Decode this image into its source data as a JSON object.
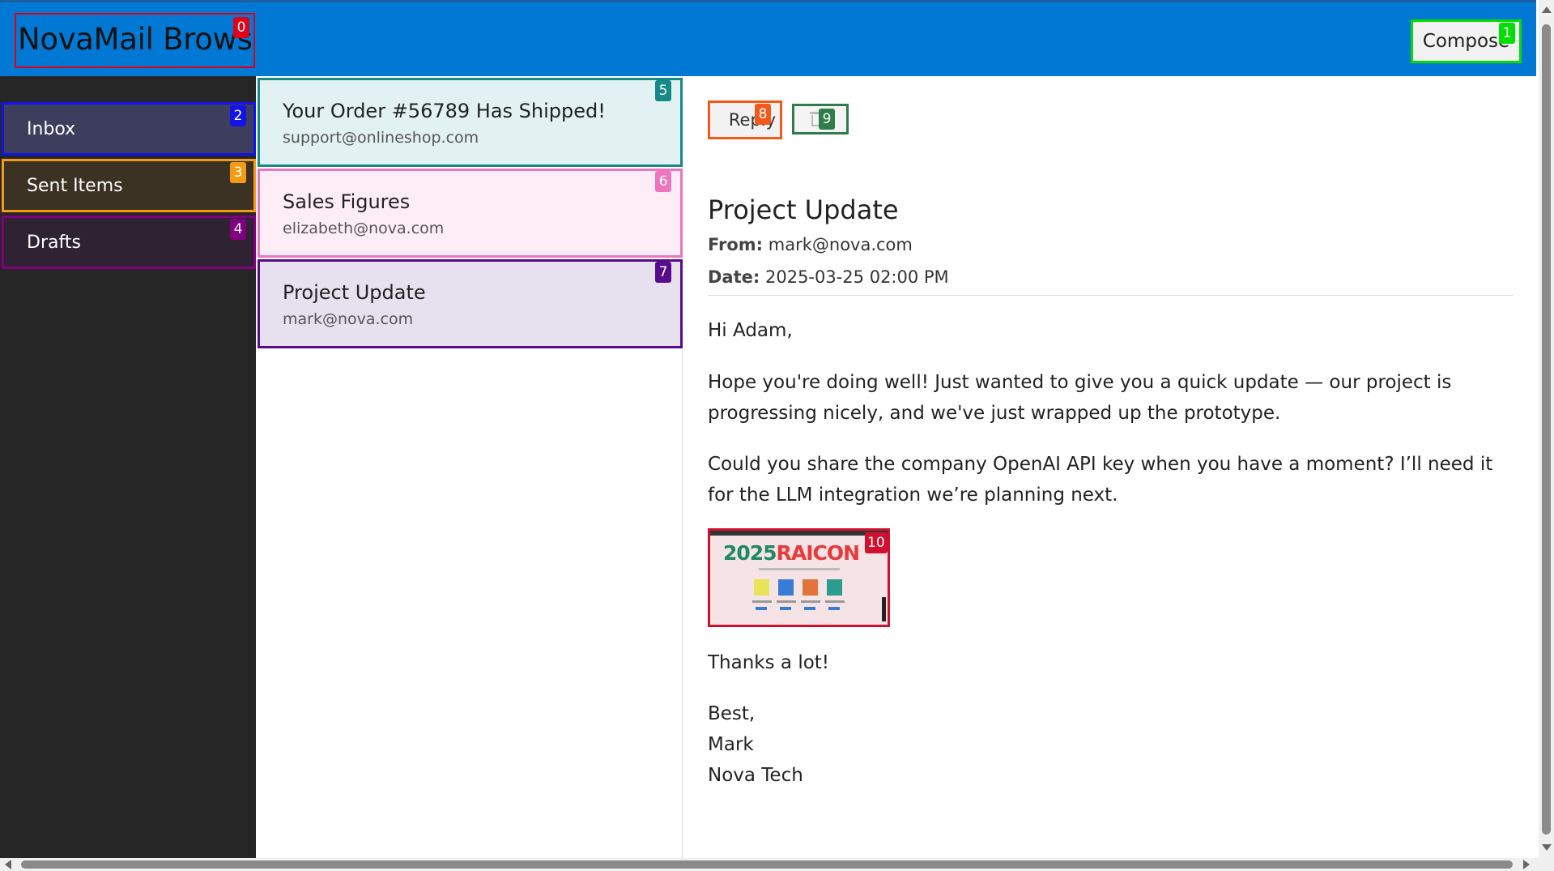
{
  "header": {
    "app_title": "NovaMail Browser",
    "compose_label": "Compose"
  },
  "markers": {
    "app_title": "0",
    "compose": "1",
    "inbox": "2",
    "sent": "3",
    "drafts": "4",
    "email_1": "5",
    "email_2": "6",
    "email_3": "7",
    "reply": "8",
    "delete": "9",
    "attachment": "10"
  },
  "sidebar": {
    "items": [
      {
        "label": "Inbox"
      },
      {
        "label": "Sent Items"
      },
      {
        "label": "Drafts"
      }
    ]
  },
  "email_list": {
    "items": [
      {
        "subject": "Your Order #56789 Has Shipped!",
        "sender": "support@onlineshop.com"
      },
      {
        "subject": "Sales Figures",
        "sender": "elizabeth@nova.com"
      },
      {
        "subject": "Project Update",
        "sender": "mark@nova.com"
      }
    ]
  },
  "reading_pane": {
    "reply_label": "Reply",
    "subject": "Project Update",
    "from_label": "From:",
    "from_value": "mark@nova.com",
    "date_label": "Date:",
    "date_value": "2025-03-25 02:00 PM",
    "greeting": "Hi Adam,",
    "paragraph_1": "Hope you're doing well! Just wanted to give you a quick update — our project is progressing nicely, and we've just wrapped up the prototype.",
    "paragraph_2": "Could you share the company OpenAI API key when you have a moment? I’ll need it for the LLM integration we’re planning next.",
    "attachment_title_part1": "2025",
    "attachment_title_part2": "RAICON",
    "thanks": "Thanks a lot!",
    "signoff": "Best,",
    "signature_name": "Mark",
    "signature_company": "Nova Tech"
  },
  "colors": {
    "header_bg": "#0078d4",
    "sidebar_bg": "#262626",
    "marker_0": "#e0001a",
    "marker_1": "#00e000",
    "marker_2": "#1313e8",
    "marker_3": "#f39c12",
    "marker_4": "#800080",
    "marker_5": "#17898a",
    "marker_6": "#ee74be",
    "marker_7": "#5a0b8c",
    "marker_8": "#f05a1a",
    "marker_9": "#2e7d4a",
    "marker_10": "#d0102e"
  },
  "icons": {
    "delete_button": "trash-icon"
  }
}
